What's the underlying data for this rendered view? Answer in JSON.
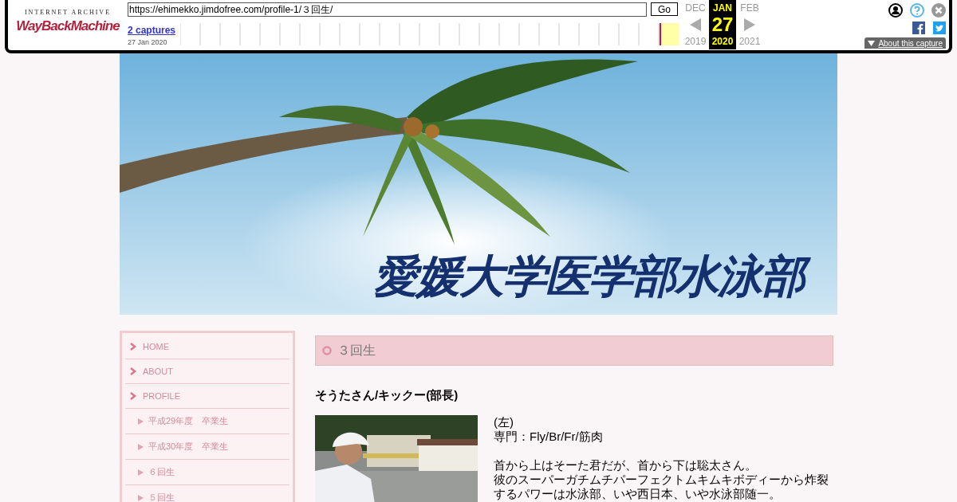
{
  "wayback": {
    "logo_top": "INTERNET ARCHIVE",
    "logo_main": "WayBackMachine",
    "url": "https://ehimekko.jimdofree.com/profile-1/３回生/",
    "go": "Go",
    "captures": "2 captures",
    "capture_date": "27 Jan 2020",
    "calendar": [
      {
        "month": "DEC",
        "year": "2019",
        "selected": false
      },
      {
        "month": "JAN",
        "day": "27",
        "year": "2020",
        "selected": true
      },
      {
        "month": "FEB",
        "year": "2021",
        "selected": false
      }
    ],
    "about": "About this capture"
  },
  "site": {
    "title": "愛媛大学医学部水泳部"
  },
  "sidebar": {
    "items": [
      {
        "label": "HOME"
      },
      {
        "label": "ABOUT"
      },
      {
        "label": "PROFILE",
        "children": [
          {
            "label": "平成29年度　卒業生"
          },
          {
            "label": "平成30年度　卒業生"
          },
          {
            "label": "６回生"
          },
          {
            "label": "５回生"
          }
        ]
      }
    ]
  },
  "content": {
    "heading": "３回生",
    "member": {
      "name": "そうたさん/キックー(部長)",
      "paragraphs": [
        [
          "(左)",
          "専門：Fly/Br/Fr/筋肉"
        ],
        [
          "首から上はそーた君だが、首から下は聡太さん。",
          "彼のスーパーガチムチパーフェクトムキムキボディーから炸裂するパワーは水泳部、いや西日本、いや水泳部随一。"
        ]
      ]
    }
  }
}
